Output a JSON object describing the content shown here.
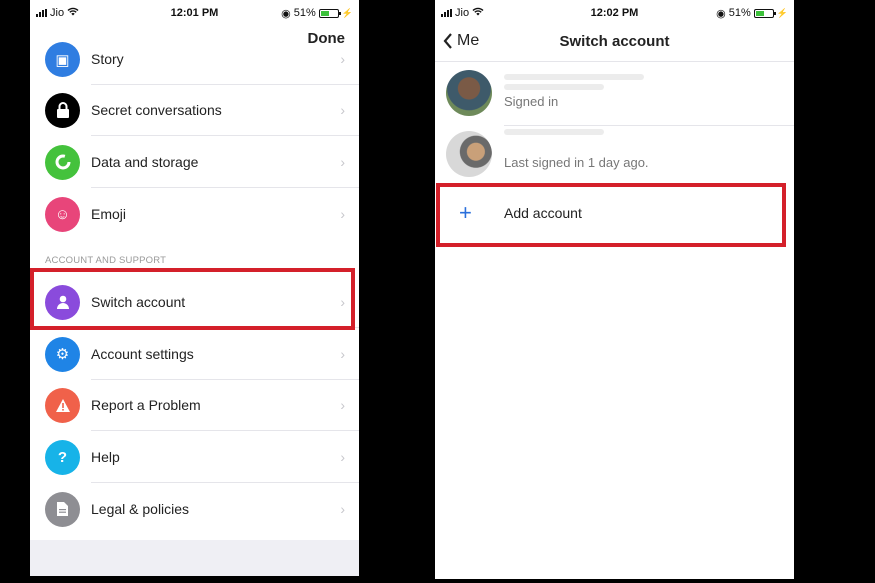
{
  "left": {
    "status": {
      "carrier": "Jio",
      "time": "12:01 PM",
      "battery": "51%",
      "battery_level": 0.51
    },
    "done_label": "Done",
    "items_top": [
      {
        "label": "Story",
        "icon": "story-icon",
        "color": "#2f7de1"
      },
      {
        "label": "Secret conversations",
        "icon": "lock-icon",
        "color": "#000000"
      },
      {
        "label": "Data and storage",
        "icon": "data-storage-icon",
        "color": "#44c23c"
      },
      {
        "label": "Emoji",
        "icon": "emoji-icon",
        "color": "#e8457a"
      }
    ],
    "section_header": "ACCOUNT AND SUPPORT",
    "items_support": [
      {
        "label": "Switch account",
        "icon": "person-icon",
        "color": "#8a4bdc"
      },
      {
        "label": "Account settings",
        "icon": "gear-icon",
        "color": "#1f84e6"
      },
      {
        "label": "Report a Problem",
        "icon": "warning-icon",
        "color": "#f0614a"
      },
      {
        "label": "Help",
        "icon": "help-icon",
        "color": "#17b3e8"
      },
      {
        "label": "Legal & policies",
        "icon": "document-icon",
        "color": "#8e8e93"
      }
    ]
  },
  "right": {
    "status": {
      "carrier": "Jio",
      "time": "12:02 PM",
      "battery": "51%",
      "battery_level": 0.51
    },
    "back_label": "Me",
    "title": "Switch account",
    "accounts": [
      {
        "status": "Signed in"
      },
      {
        "status": "Last signed in 1 day ago."
      }
    ],
    "add_label": "Add account"
  },
  "colors": {
    "highlight": "#d4202a",
    "accent": "#2a6fdb"
  }
}
